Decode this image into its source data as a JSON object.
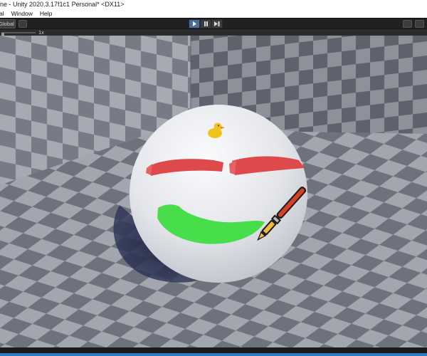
{
  "window": {
    "title": "ne - Unity 2020.3.17f1c1 Personal* <DX11>"
  },
  "menubar": {
    "items": [
      "al",
      "Window",
      "Help"
    ]
  },
  "toolbar": {
    "global_label": "Global",
    "play_icon": "play-icon",
    "pause_icon": "pause-icon",
    "step_icon": "step-icon"
  },
  "scene": {
    "timescale_label": "1x"
  },
  "colors": {
    "checker_light": "#a4a8b1",
    "checker_dark": "#747882",
    "sphere": "#e9ebef",
    "red_paint": "#e14b4d",
    "green_paint": "#46e04a",
    "duck": "#f0c419",
    "brush_red": "#d64026",
    "accent_bar": "#2f7bc1"
  }
}
